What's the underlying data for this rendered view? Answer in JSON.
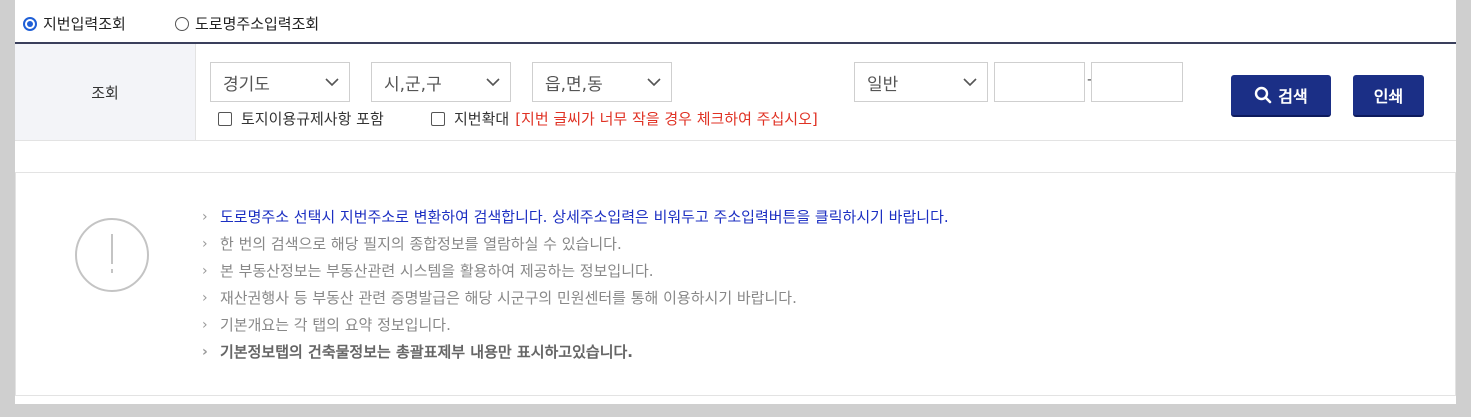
{
  "radios": [
    {
      "label": "지번입력조회",
      "checked": true
    },
    {
      "label": "도로명주소입력조회",
      "checked": false
    }
  ],
  "search": {
    "label": "조회",
    "province": "경기도",
    "city": "시,군,구",
    "town": "읍,면,동",
    "lot_type": "일반",
    "main_number": "",
    "sub_number": "",
    "dash": "-",
    "search_button": "검색",
    "print_button": "인쇄",
    "option_land_use": "토지이용규제사항 포함",
    "option_zoom": "지번확대",
    "option_zoom_note": "[지번 글씨가 너무 작을 경우 체크하여 주십시오]"
  },
  "notes": [
    "도로명주소 선택시 지번주소로 변환하여 검색합니다. 상세주소입력은 비워두고 주소입력버튼을 클릭하시기 바랍니다.",
    "한 번의 검색으로 해당 필지의 종합정보를 열람하실 수 있습니다.",
    "본 부동산정보는 부동산관련 시스템을 활용하여 제공하는 정보입니다.",
    "재산권행사 등 부동산 관련 증명발급은 해당 시군구의 민원센터를 통해 이용하시기 바랍니다.",
    "기본개요는 각 탭의 요약 정보입니다.",
    "기본정보탭의 건축물정보는 총괄표제부 내용만 표시하고있습니다."
  ],
  "colors": {
    "button": "#1b2f86",
    "warning": "#e03224",
    "link_note": "#1c2fc2",
    "radio_accent": "#1f5fd6"
  },
  "icons": {
    "radio_checked": "radio-checked-icon",
    "radio_unchecked": "radio-unchecked-icon",
    "select": "chevron-down-icon",
    "search": "search-icon",
    "info": "exclamation-circle-icon"
  }
}
